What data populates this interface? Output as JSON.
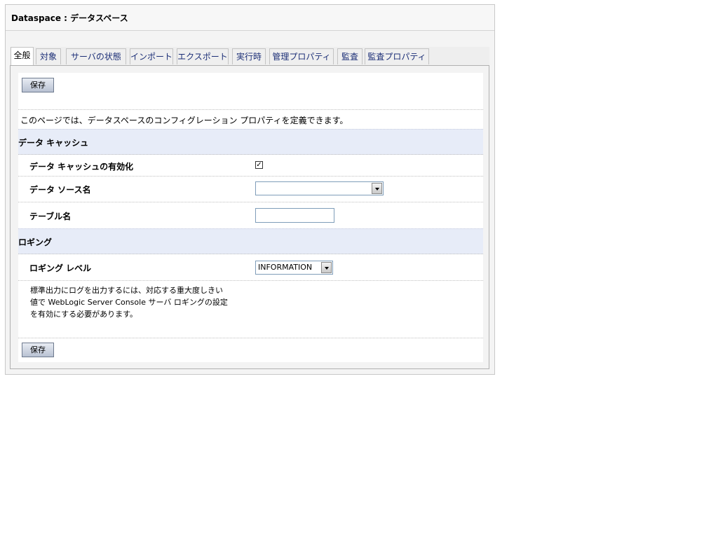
{
  "header": {
    "title": "Dataspace : データスペース"
  },
  "tabs": [
    {
      "label": "全般"
    },
    {
      "label": "対象"
    },
    {
      "label": "サーバの状態"
    },
    {
      "label": "インポート"
    },
    {
      "label": "エクスポート"
    },
    {
      "label": "実行時"
    },
    {
      "label": "管理プロパティ"
    },
    {
      "label": "監査"
    },
    {
      "label": "監査プロパティ"
    }
  ],
  "actions": {
    "save_top": "保存",
    "save_bottom": "保存"
  },
  "description": "このページでは、データスペースのコンフィグレーション プロパティを定義できます。",
  "data_cache": {
    "section_title": "データ キャッシュ",
    "enable_label": "データ キャッシュの有効化",
    "enable_checked": true,
    "enable_mark": "✓",
    "datasource_label": "データ ソース名",
    "datasource_value": "",
    "table_label": "テーブル名",
    "table_value": ""
  },
  "logging": {
    "section_title": "ロギング",
    "level_label": "ロギング レベル",
    "level_value": "INFORMATION",
    "help_lines": [
      "標準出力にログを出力するには、対応する重大度しきい",
      "値で WebLogic Server Console サーバ ロギングの設定",
      "を有効にする必要があります。"
    ]
  }
}
